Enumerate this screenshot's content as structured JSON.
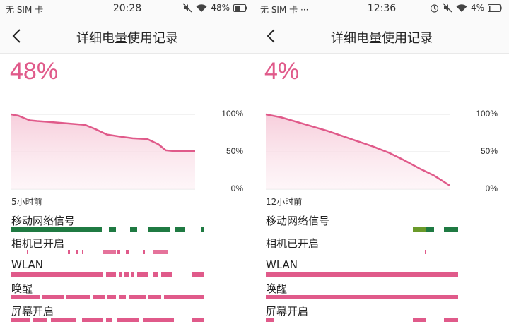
{
  "colors": {
    "accent": "#e05a8a",
    "mobile_signal": "#1f7a42",
    "mobile_signal_weak": "#6a9a2a"
  },
  "left": {
    "statusbar": {
      "carrier": "无 SIM 卡",
      "time": "20:28",
      "battery_text": "48%",
      "icons": [
        "mute-icon",
        "wifi-icon",
        "battery-icon"
      ]
    },
    "header": {
      "title": "详细电量使用记录",
      "back_icon": "chevron-left-icon"
    },
    "battery_percent": "48%",
    "chart_data": {
      "type": "area",
      "y_ticks": [
        "100%",
        "50%",
        "0%"
      ],
      "x_start_label": "5小时前",
      "ylim": [
        0,
        100
      ],
      "x_hours": [
        0,
        0.2,
        0.5,
        0.7,
        1.0,
        1.5,
        2.0,
        2.3,
        2.6,
        3.0,
        3.3,
        3.7,
        4.0,
        4.2,
        4.4,
        4.6,
        5.0
      ],
      "values": [
        100,
        98,
        92,
        91,
        90,
        88,
        86,
        80,
        73,
        70,
        68,
        67,
        60,
        52,
        51,
        51,
        51
      ]
    },
    "rows": [
      {
        "label": "移动网络信号"
      },
      {
        "label": "相机已开启"
      },
      {
        "label": "WLAN"
      },
      {
        "label": "唤醒"
      },
      {
        "label": "屏幕开启"
      }
    ]
  },
  "right": {
    "statusbar": {
      "carrier": "无 SIM 卡 ···",
      "time": "12:36",
      "battery_text": "4%",
      "icons": [
        "alarm-icon",
        "mute-icon",
        "wifi-icon",
        "battery-icon"
      ]
    },
    "header": {
      "title": "详细电量使用记录",
      "back_icon": "chevron-left-icon"
    },
    "battery_percent": "4%",
    "chart_data": {
      "type": "area",
      "y_ticks": [
        "100%",
        "50%",
        "0%"
      ],
      "x_start_label": "12小时前",
      "ylim": [
        0,
        100
      ],
      "x_hours": [
        0,
        1,
        2,
        3,
        4,
        5,
        6,
        7,
        8,
        9,
        10,
        11,
        12
      ],
      "values": [
        100,
        96,
        90,
        84,
        78,
        71,
        64,
        57,
        49,
        39,
        28,
        18,
        5
      ]
    },
    "rows": [
      {
        "label": "移动网络信号"
      },
      {
        "label": "相机已开启"
      },
      {
        "label": "WLAN"
      },
      {
        "label": "唤醒"
      },
      {
        "label": "屏幕开启"
      }
    ]
  }
}
